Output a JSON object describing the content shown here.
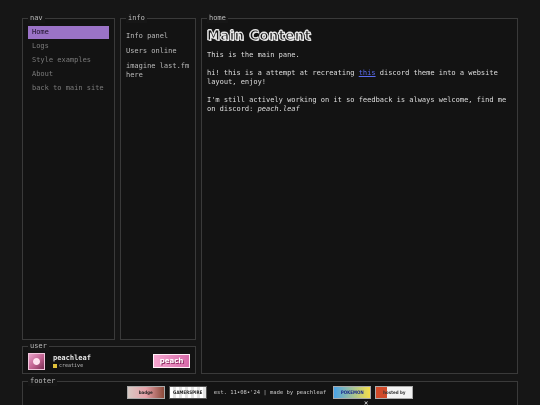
{
  "nav": {
    "legend": "nav",
    "items": [
      {
        "label": "Home",
        "active": true
      },
      {
        "label": "Logs",
        "active": false
      },
      {
        "label": "Style examples",
        "active": false
      },
      {
        "label": "About",
        "active": false
      },
      {
        "label": "back to main site",
        "active": false
      }
    ]
  },
  "info": {
    "legend": "info",
    "items": [
      {
        "label": "Info panel"
      },
      {
        "label": "Users online"
      },
      {
        "label": "imagine last.fm here"
      }
    ]
  },
  "home": {
    "legend": "home",
    "title": "Main Content",
    "intro": "This is the main pane.",
    "para2_before": "hi! this is a attempt at recreating ",
    "para2_link": "this",
    "para2_after": " discord theme into a website layout, enjoy!",
    "para3_before": "I'm still actively working on it so feedback is always welcome, find me on discord: ",
    "para3_handle": "peach.leaf"
  },
  "user": {
    "legend": "user",
    "name": "peachleaf",
    "status": "creative",
    "badge": "peach"
  },
  "footer": {
    "legend": "footer",
    "text": "est. 11•08•'24 | made by peachleaf",
    "badges": [
      "badge",
      "GAMERSPIRE GAMER",
      "POKEMON",
      "hosted by NEOCITIES"
    ]
  },
  "colors": {
    "accent": "#9b73c7",
    "link": "#5b6cf0",
    "status_dot": "#e0c13a"
  }
}
